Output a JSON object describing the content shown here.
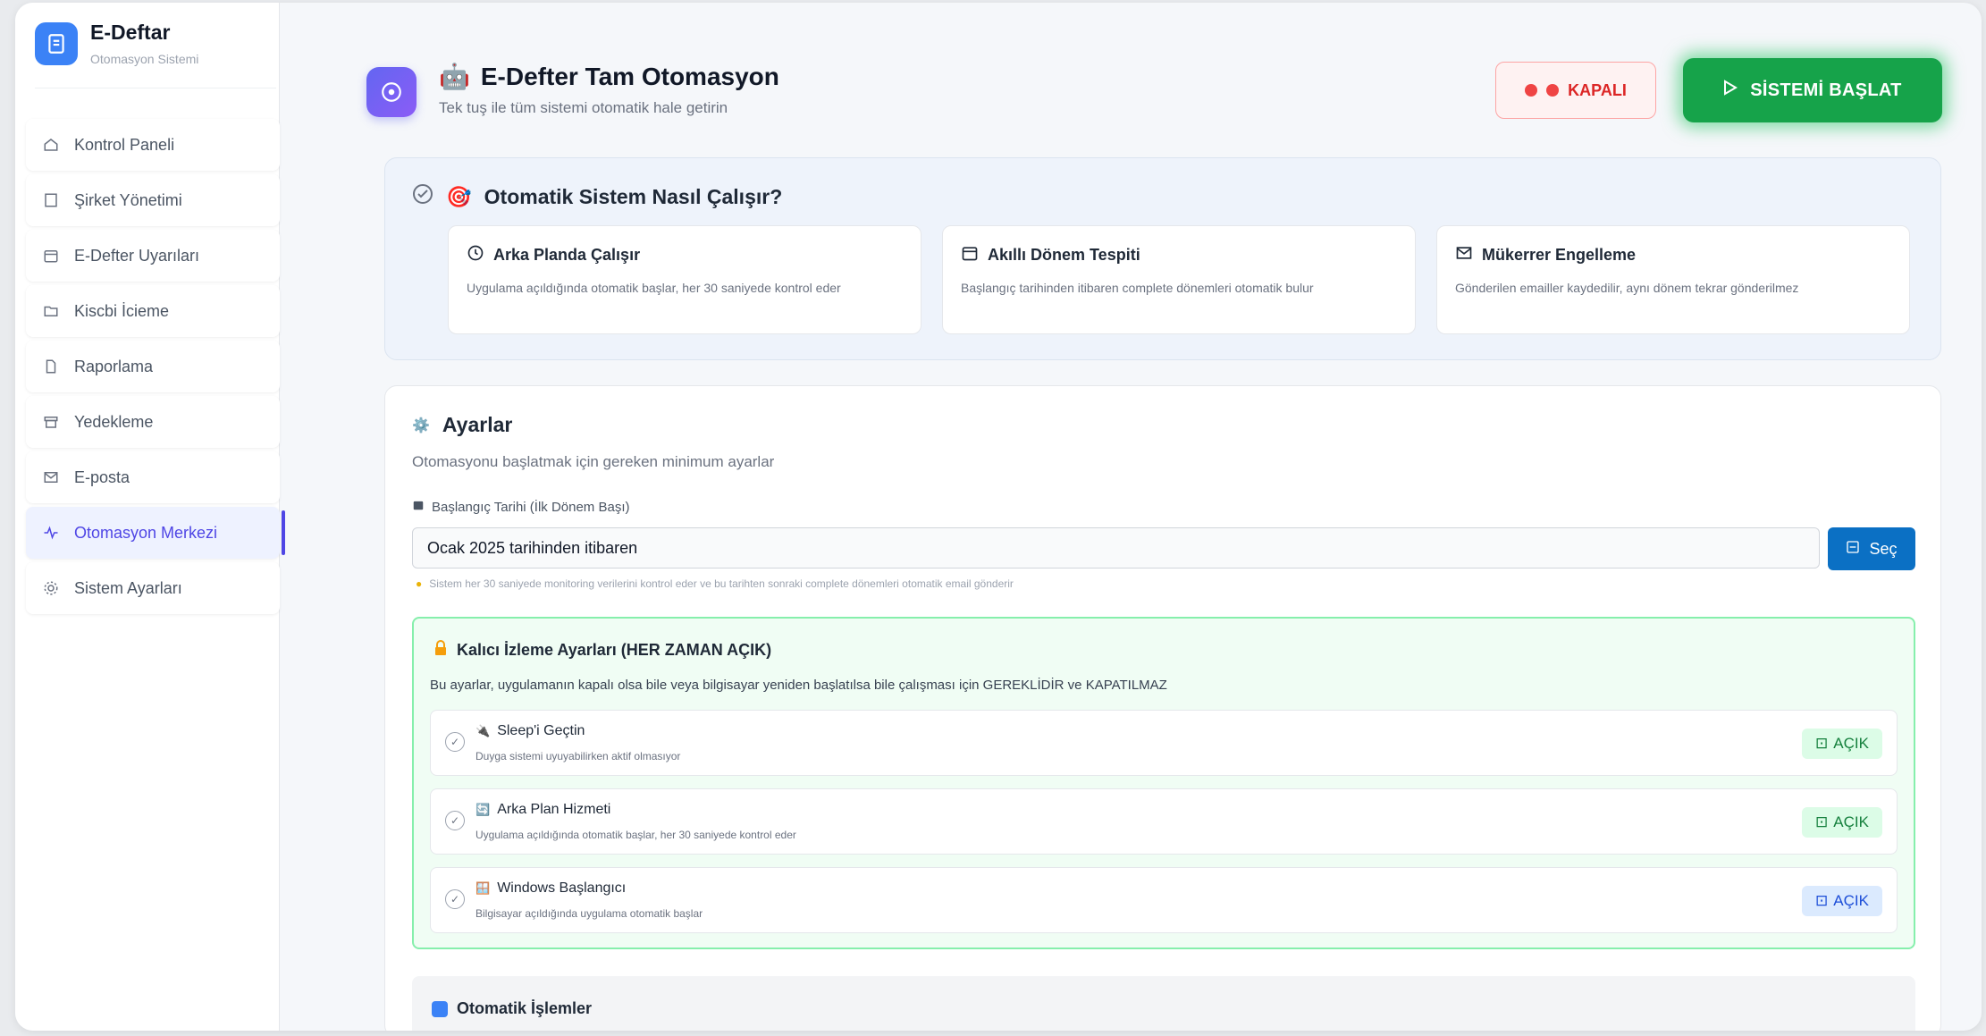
{
  "brand": {
    "title": "E-Deftar",
    "subtitle": "Otomasyon Sistemi"
  },
  "sidebar": {
    "items": [
      {
        "label": "Kontrol Paneli",
        "icon": "home-icon"
      },
      {
        "label": "Şirket Yönetimi",
        "icon": "building-icon"
      },
      {
        "label": "E-Defter Uyarıları",
        "icon": "calendar-icon"
      },
      {
        "label": "Kiscbi İcieme",
        "icon": "folder-icon"
      },
      {
        "label": "Raporlama",
        "icon": "document-icon"
      },
      {
        "label": "Yedekleme",
        "icon": "archive-icon"
      },
      {
        "label": "E-posta",
        "icon": "mail-icon"
      },
      {
        "label": "Otomasyon Merkezi",
        "icon": "activity-icon",
        "active": true
      },
      {
        "label": "Sistem Ayarları",
        "icon": "gear-icon"
      }
    ]
  },
  "header": {
    "emoji": "🤖",
    "title": "E-Defter Tam Otomasyon",
    "subtitle": "Tek tuş ile tüm sistemi otomatik hale getirin",
    "status_label": "KAPALI",
    "start_label": "SİSTEMİ BAŞLAT"
  },
  "how": {
    "emoji": "🎯",
    "title": "Otomatik Sistem Nasıl Çalışır?",
    "features": [
      {
        "title": "Arka Planda Çalışır",
        "desc": "Uygulama açıldığında otomatik başlar, her 30 saniyede kontrol eder",
        "icon": "clock-icon"
      },
      {
        "title": "Akıllı Dönem Tespiti",
        "desc": "Başlangıç tarihinden itibaren complete dönemleri otomatik bulur",
        "icon": "calendar-icon"
      },
      {
        "title": "Mükerrer Engelleme",
        "desc": "Gönderilen emailler kaydedilir, aynı dönem tekrar gönderilmez",
        "icon": "mail-icon"
      }
    ]
  },
  "settings": {
    "emoji": "⚙️",
    "title": "Ayarlar",
    "subtitle": "Otomasyonu başlatmak için gereken minimum ayarlar",
    "start_date_label": "Başlangıç Tarihi (İlk Dönem Başı)",
    "start_date_value": "Ocak 2025 tarihinden itibaren",
    "save_label": "Seç",
    "hint": "Sistem her 30 saniyede monitoring verilerini kontrol eder ve bu tarihten sonraki complete dönemleri otomatik email gönderir",
    "permanent": {
      "title": "Kalıcı İzleme Ayarları (HER ZAMAN AÇIK)",
      "desc": "Bu ayarlar, uygulamanın kapalı olsa bile veya bilgisayar yeniden başlatılsa bile çalışması için GEREKLİDİR ve KAPATILMAZ",
      "rows": [
        {
          "emoji": "🔌",
          "title": "Sleep'i Geçtin",
          "desc": "Duyga sistemi uyuyabilirken aktif olmasıyor",
          "badge": "AÇIK",
          "badge_color": "green"
        },
        {
          "emoji": "🔄",
          "title": "Arka Plan Hizmeti",
          "desc": "Uygulama açıldığında otomatik başlar, her 30 saniyede kontrol eder",
          "badge": "AÇIK",
          "badge_color": "green"
        },
        {
          "emoji": "🪟",
          "title": "Windows Başlangıcı",
          "desc": "Bilgisayar açıldığında uygulama otomatik başlar",
          "badge": "AÇIK",
          "badge_color": "blue"
        }
      ]
    },
    "auto_title": "Otomatik İşlemler"
  },
  "colors": {
    "accent": "#4f46e5",
    "start_button": "#16a34a",
    "closed": "#dc2626",
    "save_button": "#0b70c4"
  }
}
